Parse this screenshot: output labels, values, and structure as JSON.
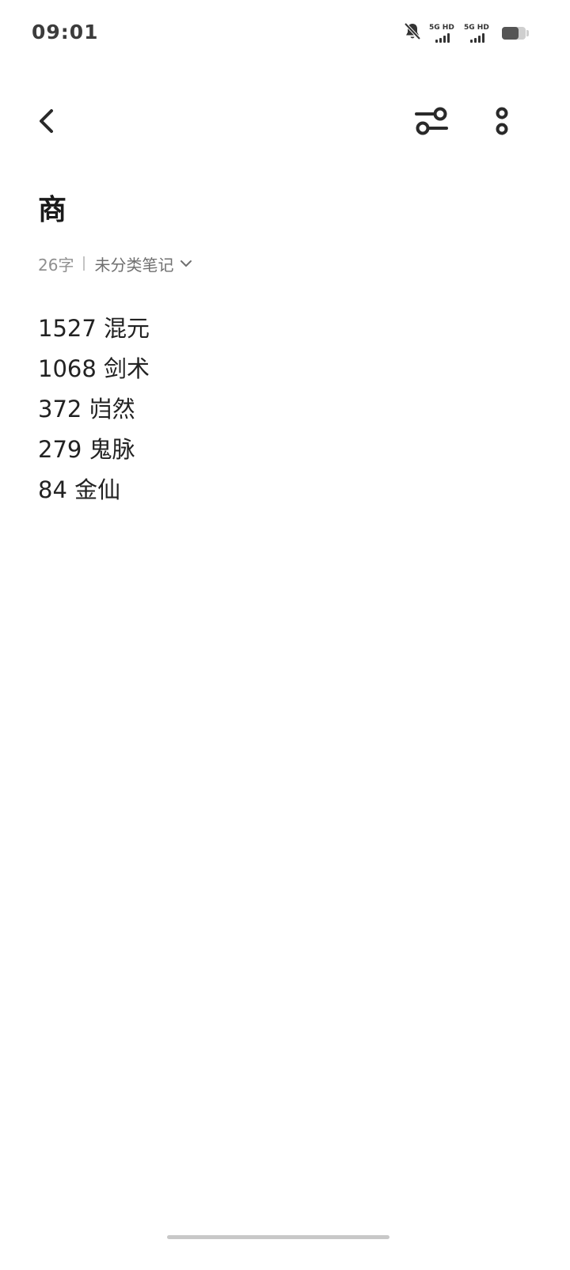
{
  "status_bar": {
    "time": "09:01",
    "icons": [
      "bell-off-icon",
      "signal-5g-icon",
      "signal-5g-icon",
      "battery-icon"
    ],
    "sim1_label": "5G HD",
    "sim2_label": "5G HD",
    "battery_level": 0.7
  },
  "toolbar": {
    "back_icon": "chevron-left-icon",
    "adjust_icon": "sliders-icon",
    "more_icon": "more-vertical-icon"
  },
  "note": {
    "title": "商",
    "word_count": "26字",
    "category": "未分类笔记",
    "category_icon": "chevron-down-icon",
    "lines": [
      "1527 混元",
      "1068 剑术",
      "372 岿然",
      "279 鬼脉",
      "84 金仙"
    ]
  },
  "colors": {
    "background": "#ffffff",
    "text": "#1f1f1f",
    "meta_text": "#8f8f8f"
  }
}
